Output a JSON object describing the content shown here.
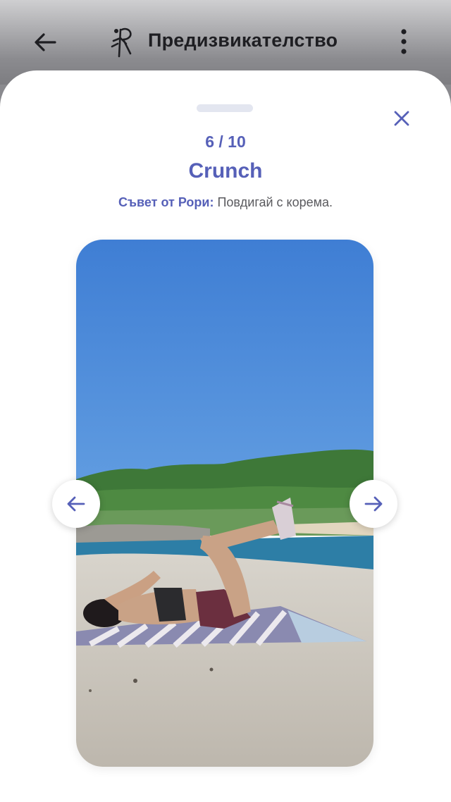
{
  "header": {
    "title": "Предизвикателство",
    "back_icon": "arrow-left-icon",
    "logo_icon": "runner-logo-icon",
    "menu_icon": "more-vertical-icon"
  },
  "sheet": {
    "counter": "6 / 10",
    "exercise_name": "Crunch",
    "tip_label": "Съвет от Рори:",
    "tip_text": " Повдигай с корема.",
    "close_icon": "close-icon",
    "prev_icon": "arrow-left-icon",
    "next_icon": "arrow-right-icon"
  },
  "colors": {
    "accent": "#5660b8",
    "sky": "#4a86d9",
    "sea": "#2f7ea3",
    "sand": "#c9c4bb",
    "trees": "#3f7a3a"
  }
}
